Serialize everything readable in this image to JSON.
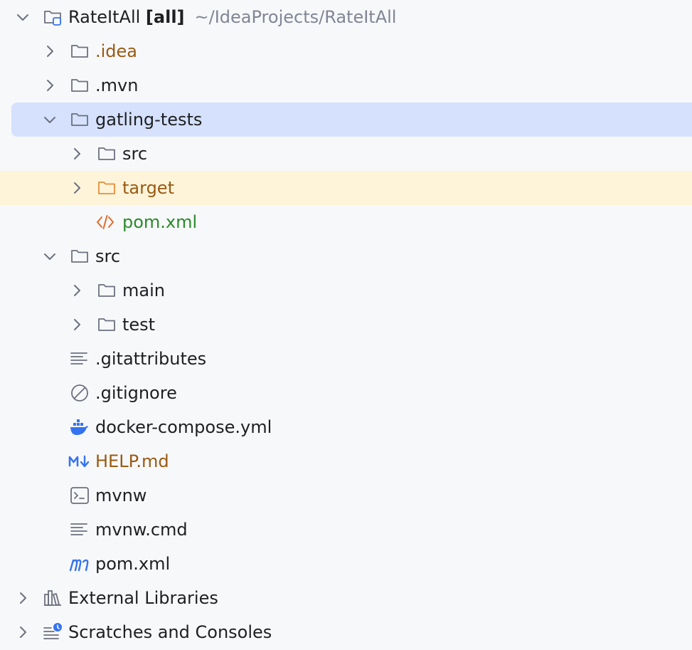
{
  "project": {
    "name": "RateItAll",
    "badge": "[all]",
    "path": "~/IdeaProjects/RateItAll"
  },
  "items": {
    "idea": ".idea",
    "mvn": ".mvn",
    "gatling_tests": "gatling-tests",
    "gatling_src": "src",
    "gatling_target": "target",
    "gatling_pom": "pom.xml",
    "src": "src",
    "src_main": "main",
    "src_test": "test",
    "gitattributes": ".gitattributes",
    "gitignore": ".gitignore",
    "docker_compose": "docker-compose.yml",
    "help_md": "HELP.md",
    "mvnw": "mvnw",
    "mvnw_cmd": "mvnw.cmd",
    "pom": "pom.xml",
    "external_libraries": "External Libraries",
    "scratches": "Scratches and Consoles"
  },
  "icons": {
    "folder": "folder-icon",
    "module": "module-folder-icon",
    "excluded_folder": "excluded-folder-icon",
    "xml": "xml-file-icon",
    "text": "text-file-icon",
    "ignore": "ignore-file-icon",
    "docker": "docker-icon",
    "markdown": "markdown-icon",
    "shell": "shell-script-icon",
    "maven": "maven-icon",
    "libraries": "libraries-icon",
    "scratches": "scratches-icon"
  },
  "colors": {
    "selected_bg": "#d5e1fd",
    "excluded_bg": "#fdf4d9",
    "modified_text": "#9a5a13",
    "added_text": "#2b8a2b",
    "path_text": "#818594"
  }
}
